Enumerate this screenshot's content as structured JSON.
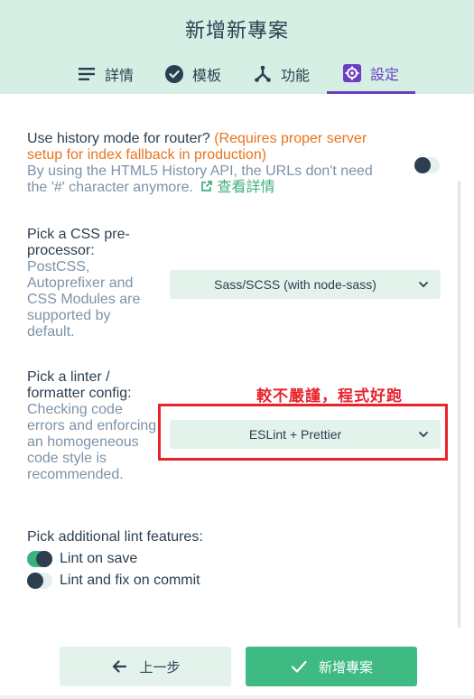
{
  "header": {
    "title": "新增新專案",
    "tabs": [
      {
        "label": "詳情",
        "icon": "list-icon"
      },
      {
        "label": "模板",
        "icon": "check-circle-icon"
      },
      {
        "label": "功能",
        "icon": "fork-icon"
      },
      {
        "label": "設定",
        "icon": "gear-icon",
        "active": true
      }
    ]
  },
  "history_mode": {
    "question": "Use history mode for router?",
    "warning": "(Requires proper server setup for index fallback in production)",
    "description": "By using the HTML5 History API, the URLs don't need the '#' character anymore.",
    "link": "查看詳情",
    "enabled": false
  },
  "css_preprocessor": {
    "label": "Pick a CSS pre-processor:",
    "description": "PostCSS, Autoprefixer and CSS Modules are supported by default.",
    "selected": "Sass/SCSS (with node-sass)"
  },
  "linter": {
    "label": "Pick a linter / formatter config:",
    "description": "Checking code errors and enforcing an homogeneous code style is recommended.",
    "selected": "ESLint + Prettier",
    "annotation": "較不嚴謹，程式好跑"
  },
  "lint_features": {
    "label": "Pick additional lint features:",
    "options": [
      {
        "label": "Lint on save",
        "enabled": true
      },
      {
        "label": "Lint and fix on commit",
        "enabled": false
      }
    ]
  },
  "footer": {
    "prev_label": "上一步",
    "create_label": "新增專案"
  },
  "colors": {
    "header_bg": "#d5efe4",
    "accent": "#6a3fc2",
    "primary_green": "#3fba83",
    "warning_orange": "#e8741e",
    "annotation_red": "#e8232d"
  }
}
